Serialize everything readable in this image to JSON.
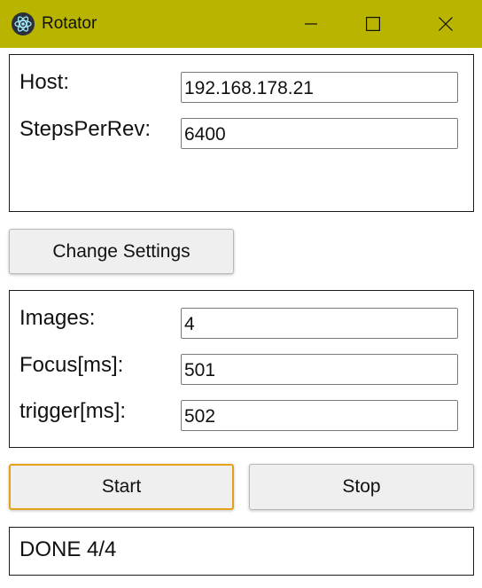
{
  "window": {
    "title": "Rotator",
    "title_bar_color": "#b8b400",
    "icon": "electron-atom-icon"
  },
  "settings_panel": {
    "host_label": "Host:",
    "host_value": "192.168.178.21",
    "steps_label": "StepsPerRev:",
    "steps_value": "6400"
  },
  "change_settings_button": "Change Settings",
  "capture_panel": {
    "images_label": "Images:",
    "images_value": "4",
    "focus_label": "Focus[ms]:",
    "focus_value": "501",
    "trigger_label": "trigger[ms]:",
    "trigger_value": "502"
  },
  "controls": {
    "start_label": "Start",
    "stop_label": "Stop",
    "focus_color": "#e3a21a"
  },
  "status": {
    "text": "DONE 4/4"
  }
}
